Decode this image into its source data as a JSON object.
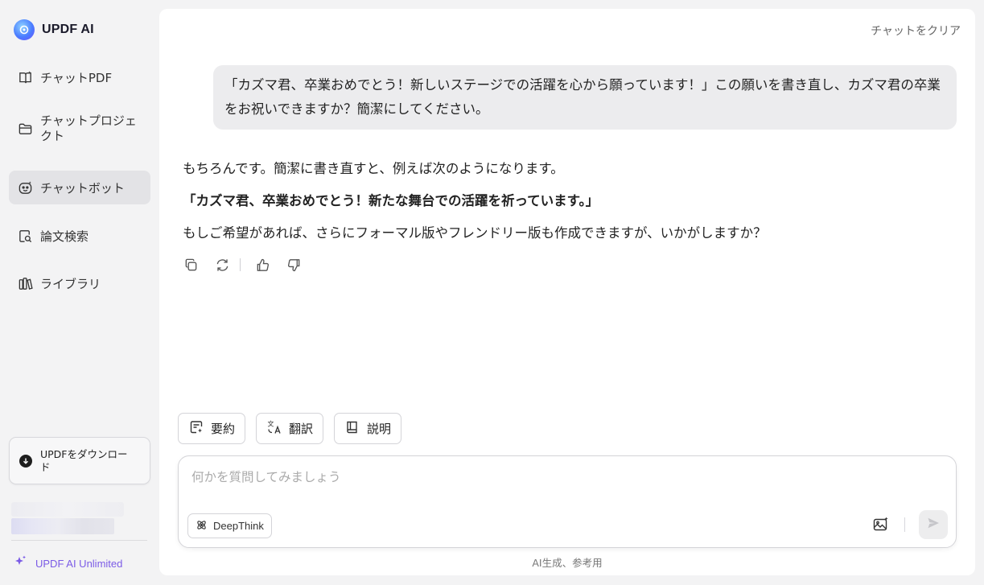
{
  "brand": {
    "title": "UPDF AI"
  },
  "sidebar": {
    "items": [
      {
        "label": "チャットPDF",
        "icon": "book-ai-icon"
      },
      {
        "label": "チャットプロジェクト",
        "icon": "folder-icon"
      },
      {
        "label": "チャットボット",
        "icon": "bot-icon",
        "active": true
      },
      {
        "label": "論文検索",
        "icon": "search-document-icon"
      },
      {
        "label": "ライブラリ",
        "icon": "library-icon"
      }
    ],
    "download_label": "UPDFをダウンロード",
    "unlimited_label": "UPDF AI Unlimited"
  },
  "header": {
    "clear_label": "チャットをクリア"
  },
  "conversation": {
    "user_message": "「カズマ君、卒業おめでとう！新しいステージでの活躍を心から願っています！」この願いを書き直し、カズマ君の卒業をお祝いできますか？簡潔にしてください。",
    "answer_intro": "もちろんです。簡潔に書き直すと、例えば次のようになります。",
    "answer_bold": "「カズマ君、卒業おめでとう！新たな舞台での活躍を祈っています。」",
    "answer_outro": "もしご希望があれば、さらにフォーマル版やフレンドリー版も作成できますが、いかがしますか？"
  },
  "quick_actions": [
    {
      "label": "要約",
      "icon": "summary-icon"
    },
    {
      "label": "翻訳",
      "icon": "translate-icon"
    },
    {
      "label": "説明",
      "icon": "explain-book-icon"
    }
  ],
  "composer": {
    "placeholder": "何かを質問してみましょう",
    "deepthink_label": "DeepThink"
  },
  "footer_note": "AI生成、参考用",
  "colors": {
    "accent": "#7b5be6",
    "panel": "#ffffff",
    "sidebar": "#f3f3f4"
  }
}
